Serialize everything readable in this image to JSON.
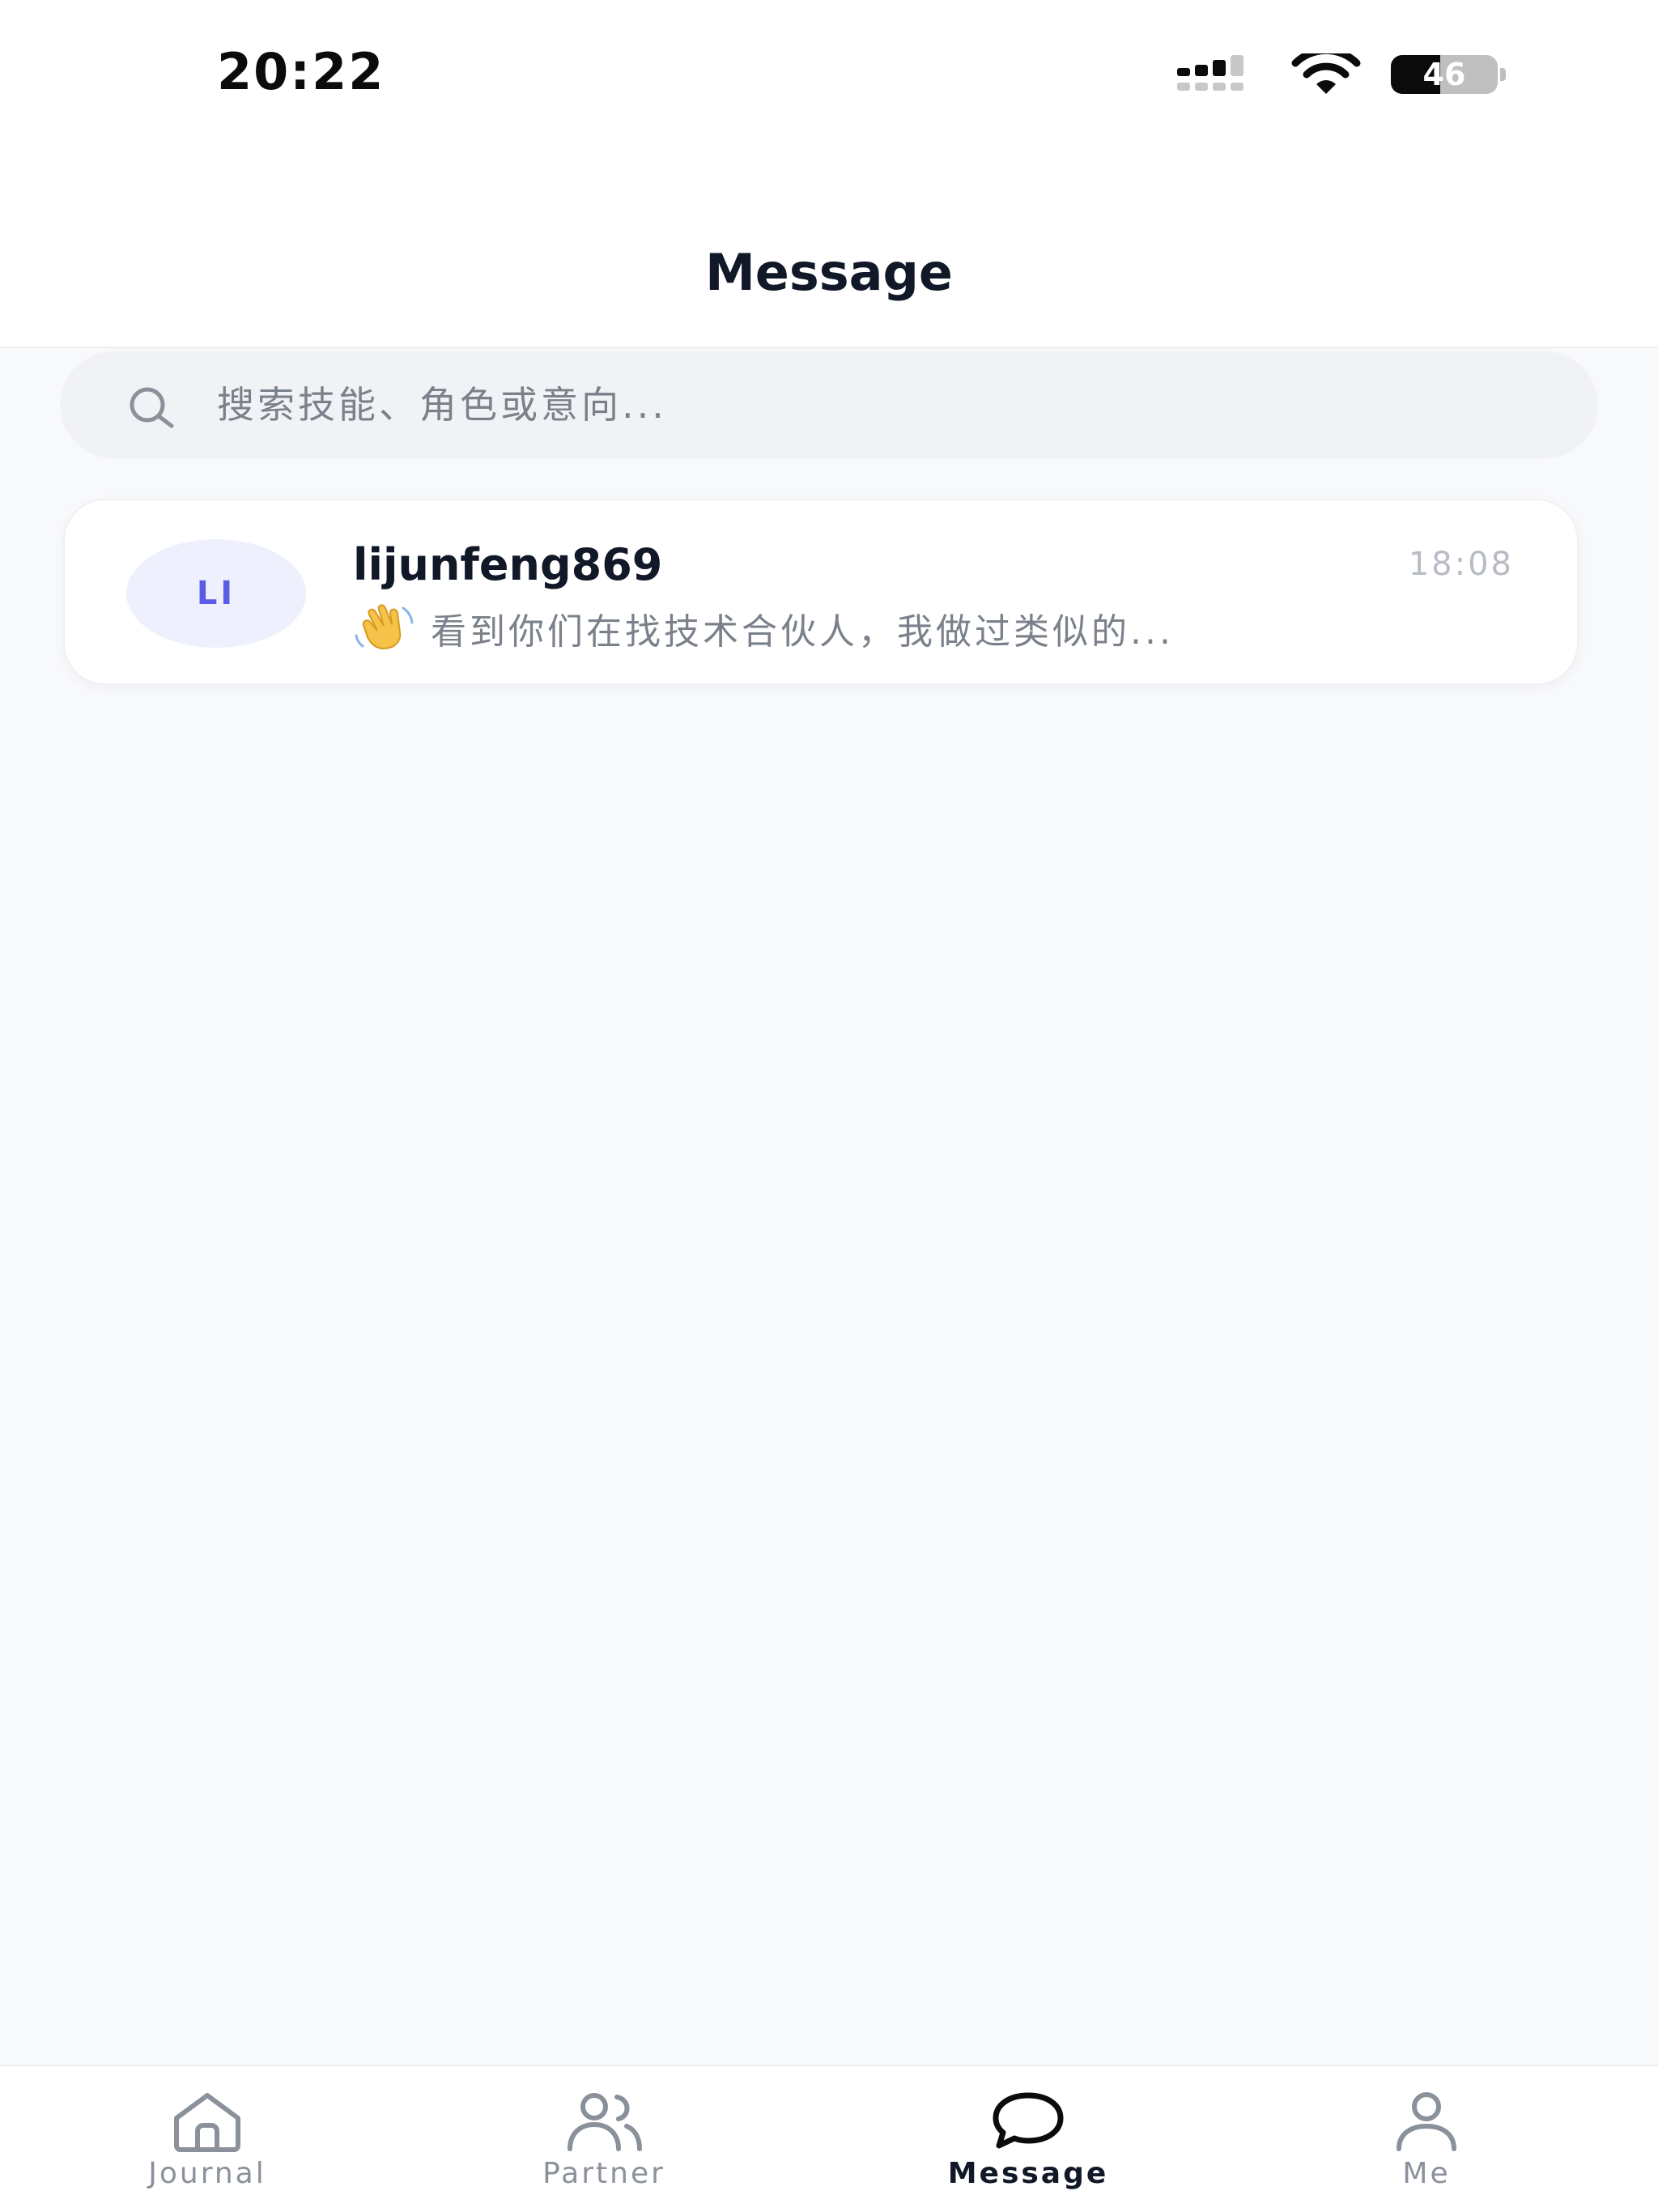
{
  "status_bar": {
    "time": "20:22",
    "battery_level": "46",
    "battery_fraction": 0.46
  },
  "header": {
    "title": "Message"
  },
  "search": {
    "placeholder": "搜索技能、角色或意向..."
  },
  "conversations": [
    {
      "avatar_initials": "LI",
      "name": "lijunfeng869",
      "time": "18:08",
      "preview_icon": "waving-hand-icon",
      "preview": "看到你们在找技术合伙人，我做过类似的..."
    }
  ],
  "tabs": [
    {
      "label": "Journal",
      "icon": "home-icon",
      "active": false
    },
    {
      "label": "Partner",
      "icon": "users-icon",
      "active": false
    },
    {
      "label": "Message",
      "icon": "chat-bubble-icon",
      "active": true
    },
    {
      "label": "Me",
      "icon": "user-icon",
      "active": false
    }
  ],
  "colors": {
    "accent": "#5b5be6",
    "avatar_bg": "#eef0fd",
    "text_primary": "#111827",
    "text_secondary": "#7b818b",
    "tab_inactive": "#8b919b",
    "background": "#f8f9fb"
  }
}
